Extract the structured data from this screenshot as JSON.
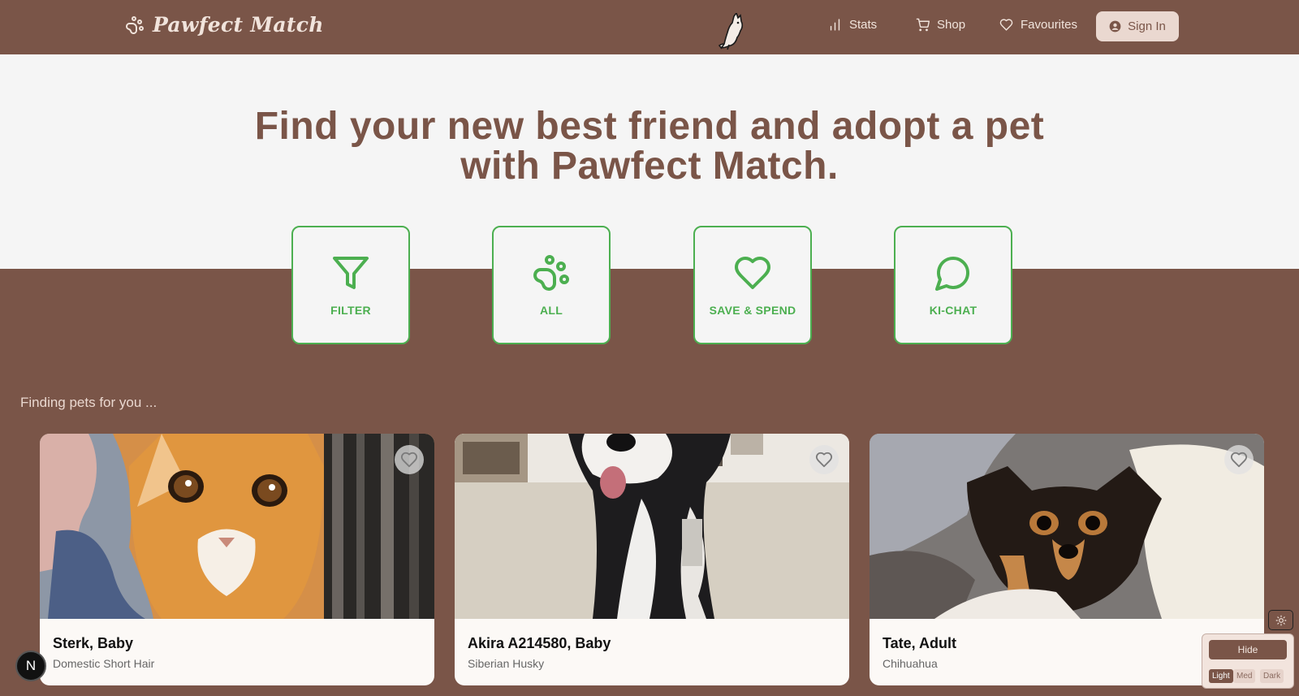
{
  "nav": {
    "brand": "Pawfect Match",
    "links": [
      {
        "label": "Stats",
        "icon": "bar-chart-icon"
      },
      {
        "label": "Shop",
        "icon": "cart-icon"
      },
      {
        "label": "Favourites",
        "icon": "heart-icon"
      }
    ],
    "signin_label": "Sign In"
  },
  "hero": {
    "headline": "Find your new best friend and adopt a pet with Pawfect Match."
  },
  "actions": [
    {
      "label": "FILTER",
      "icon": "filter-icon"
    },
    {
      "label": "ALL",
      "icon": "paw-icon"
    },
    {
      "label": "SAVE & SPEND",
      "icon": "heart-icon"
    },
    {
      "label": "KI-CHAT",
      "icon": "chat-bubble-icon"
    }
  ],
  "status_text": "Finding pets for you ...",
  "pets": [
    {
      "name": "Sterk, Baby",
      "breed": "Domestic Short Hair"
    },
    {
      "name": "Akira A214580, Baby",
      "breed": "Siberian Husky"
    },
    {
      "name": "Tate, Adult",
      "breed": "Chihuahua"
    }
  ],
  "dev_badge": "N",
  "theme_panel": {
    "hide_label": "Hide",
    "modes": [
      "Light",
      "Med",
      "Dark"
    ],
    "active_mode": "Light"
  },
  "colors": {
    "brand_brown": "#7a5548",
    "accent_green": "#4caf50",
    "hero_background": "#f5f5f5"
  }
}
